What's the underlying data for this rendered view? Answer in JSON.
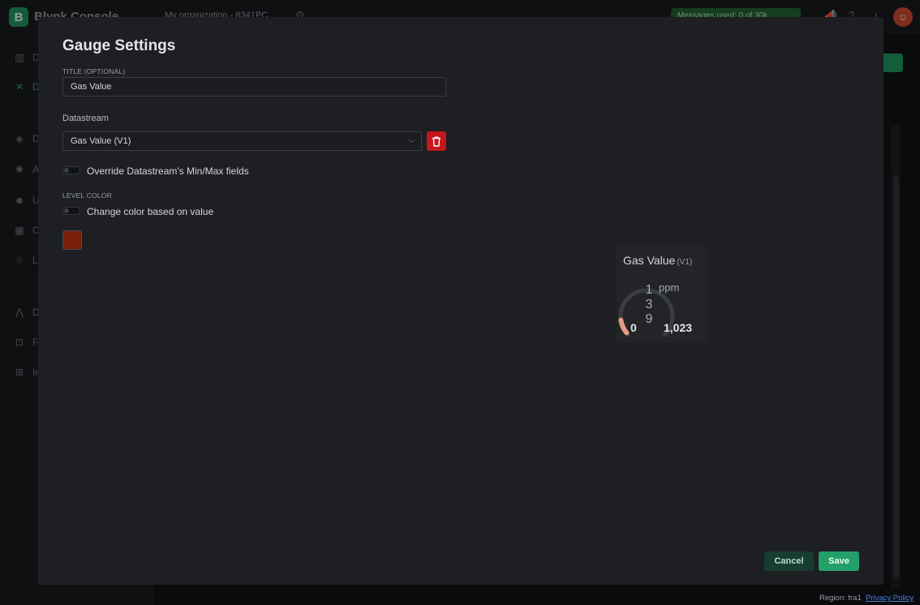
{
  "app": {
    "brand_letter": "B",
    "brand_name": "Blynk.Console",
    "organization": "My organization - 8341PC",
    "messages_usage": "Messages used: 0 of 30k"
  },
  "sidebar": {
    "items": [
      {
        "label": "D",
        "icon": "chart-icon"
      },
      {
        "label": "D",
        "icon": "wrench-icon",
        "active": true
      },
      {
        "label": "D",
        "icon": "cube-icon"
      },
      {
        "label": "A",
        "icon": "automation-icon"
      },
      {
        "label": "U",
        "icon": "users-icon"
      },
      {
        "label": "O",
        "icon": "building-icon"
      },
      {
        "label": "L",
        "icon": "location-icon"
      },
      {
        "label": "D",
        "icon": "developer-icon"
      },
      {
        "label": "F",
        "icon": "fleet-icon"
      },
      {
        "label": "In",
        "icon": "integration-icon"
      }
    ]
  },
  "modal": {
    "title": "Gauge Settings",
    "title_field": {
      "label": "TITLE (OPTIONAL)",
      "value": "Gas Value"
    },
    "datastream": {
      "label": "Datastream",
      "selected": "Gas Value (V1)"
    },
    "override_toggle": {
      "label": "Override Datastream's Min/Max fields",
      "on": false
    },
    "level_color": {
      "label": "LEVEL COLOR",
      "toggle_label": "Change color based on value",
      "on": false,
      "color": "#7a1e0a"
    },
    "preview": {
      "title": "Gas Value",
      "pin": "(V1)",
      "value": "139",
      "unit": "ppm",
      "min": "0",
      "max": "1,023",
      "level_fraction": 0.136,
      "arc_color": "#e59a86"
    },
    "buttons": {
      "cancel": "Cancel",
      "save": "Save"
    }
  },
  "footer": {
    "region": "Region: fra1",
    "privacy": "Privacy Policy"
  },
  "colors": {
    "accent": "#23a06a",
    "danger": "#c4161c"
  }
}
